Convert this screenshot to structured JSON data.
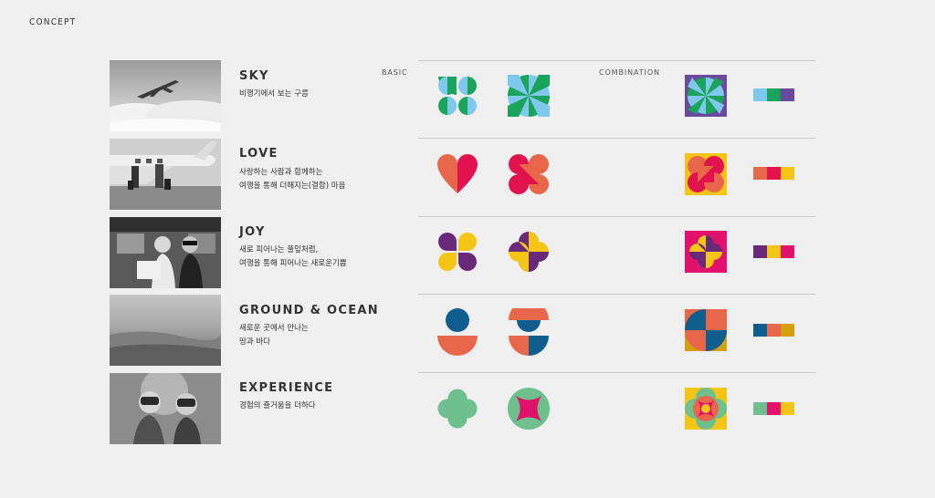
{
  "page_label": "CONCEPT",
  "column_labels": {
    "basic": "BASIC",
    "combination": "COMBINATION"
  },
  "rows": [
    {
      "title": "SKY",
      "lines": [
        "비행기에서 보는 구름"
      ],
      "colors": [
        "#7ec8ee",
        "#1aa35b",
        "#6a4a9c"
      ]
    },
    {
      "title": "LOVE",
      "lines": [
        "사랑하는 사람과 함께하는",
        "여행을 통해 더해지는(결합) 마음"
      ],
      "colors": [
        "#e8674a",
        "#e2124f",
        "#f5c515"
      ]
    },
    {
      "title": "JOY",
      "lines": [
        "새로 피어나는 풀잎처럼,",
        "여행을 통해 피어나는 새로운기쁨"
      ],
      "colors": [
        "#6a2a7a",
        "#f5c515",
        "#e2126c"
      ]
    },
    {
      "title": "GROUND & OCEAN",
      "lines": [
        "새로운 곳에서 만나는",
        "땅과 바다"
      ],
      "colors": [
        "#0f5e8e",
        "#e8674a",
        "#d4a012"
      ]
    },
    {
      "title": "EXPERIENCE",
      "lines": [
        "경험의 즐거움을 더하다"
      ],
      "colors": [
        "#6dbf8e",
        "#e2126c",
        "#f5c515"
      ]
    }
  ]
}
